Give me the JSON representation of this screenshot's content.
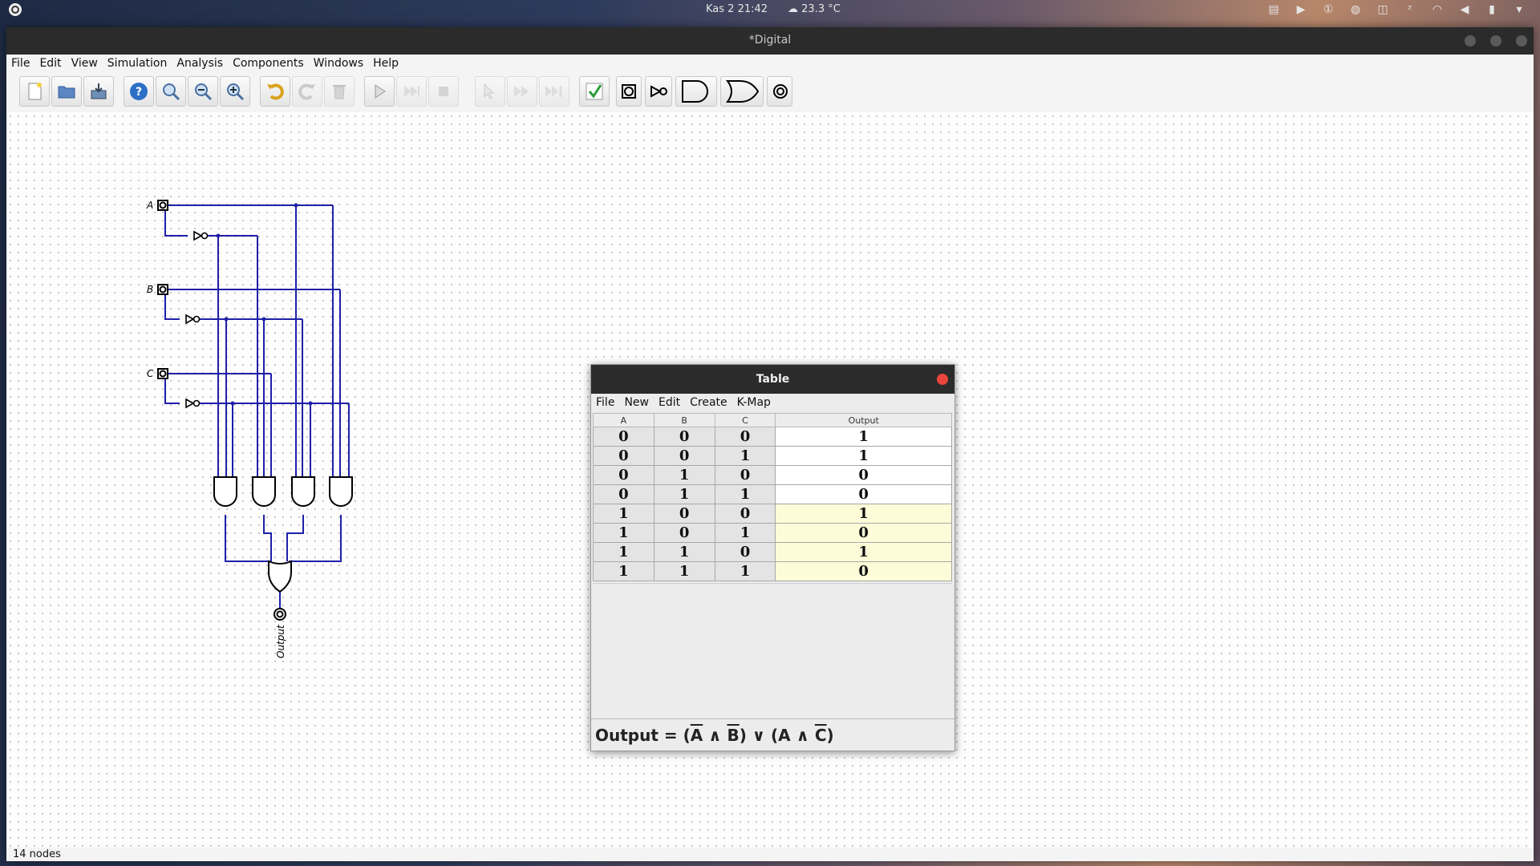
{
  "system": {
    "clock": "Kas 2  21:42",
    "weather": "23.3 °C"
  },
  "window": {
    "title": "*Digital",
    "menu": [
      "File",
      "Edit",
      "View",
      "Simulation",
      "Analysis",
      "Components",
      "Windows",
      "Help"
    ]
  },
  "toolbar": {
    "icons": [
      "new-file-icon",
      "open-file-icon",
      "save-file-icon",
      "help-icon",
      "zoom-fit-icon",
      "zoom-out-icon",
      "zoom-in-icon",
      "undo-icon",
      "redo-icon",
      "delete-icon",
      "run-icon",
      "step-icon",
      "stop-icon",
      "select-icon",
      "fast-forward-icon",
      "skip-icon",
      "check-icon",
      "input-icon",
      "not-gate-icon",
      "and-gate-icon",
      "or-gate-icon",
      "output-icon"
    ]
  },
  "circuit": {
    "inputs": [
      "A",
      "B",
      "C"
    ],
    "output": "Output"
  },
  "status": {
    "text": "14 nodes"
  },
  "table_dialog": {
    "title": "Table",
    "menu": [
      "File",
      "New",
      "Edit",
      "Create",
      "K-Map"
    ],
    "headers": [
      "A",
      "B",
      "C",
      "Output"
    ],
    "rows": [
      [
        "0",
        "0",
        "0",
        "1"
      ],
      [
        "0",
        "0",
        "1",
        "1"
      ],
      [
        "0",
        "1",
        "0",
        "0"
      ],
      [
        "0",
        "1",
        "1",
        "0"
      ],
      [
        "1",
        "0",
        "0",
        "1"
      ],
      [
        "1",
        "0",
        "1",
        "0"
      ],
      [
        "1",
        "1",
        "0",
        "1"
      ],
      [
        "1",
        "1",
        "1",
        "0"
      ]
    ],
    "expression": {
      "lhs": "Output",
      "eq": "=",
      "t1a": "A",
      "t1b": "B",
      "t2a": "A",
      "t2b": "C",
      "and": "∧",
      "or": "∨"
    }
  },
  "colors": {
    "wire": "#1f1fa8",
    "highlight": "#fdfbd8",
    "close": "#e8453c"
  }
}
